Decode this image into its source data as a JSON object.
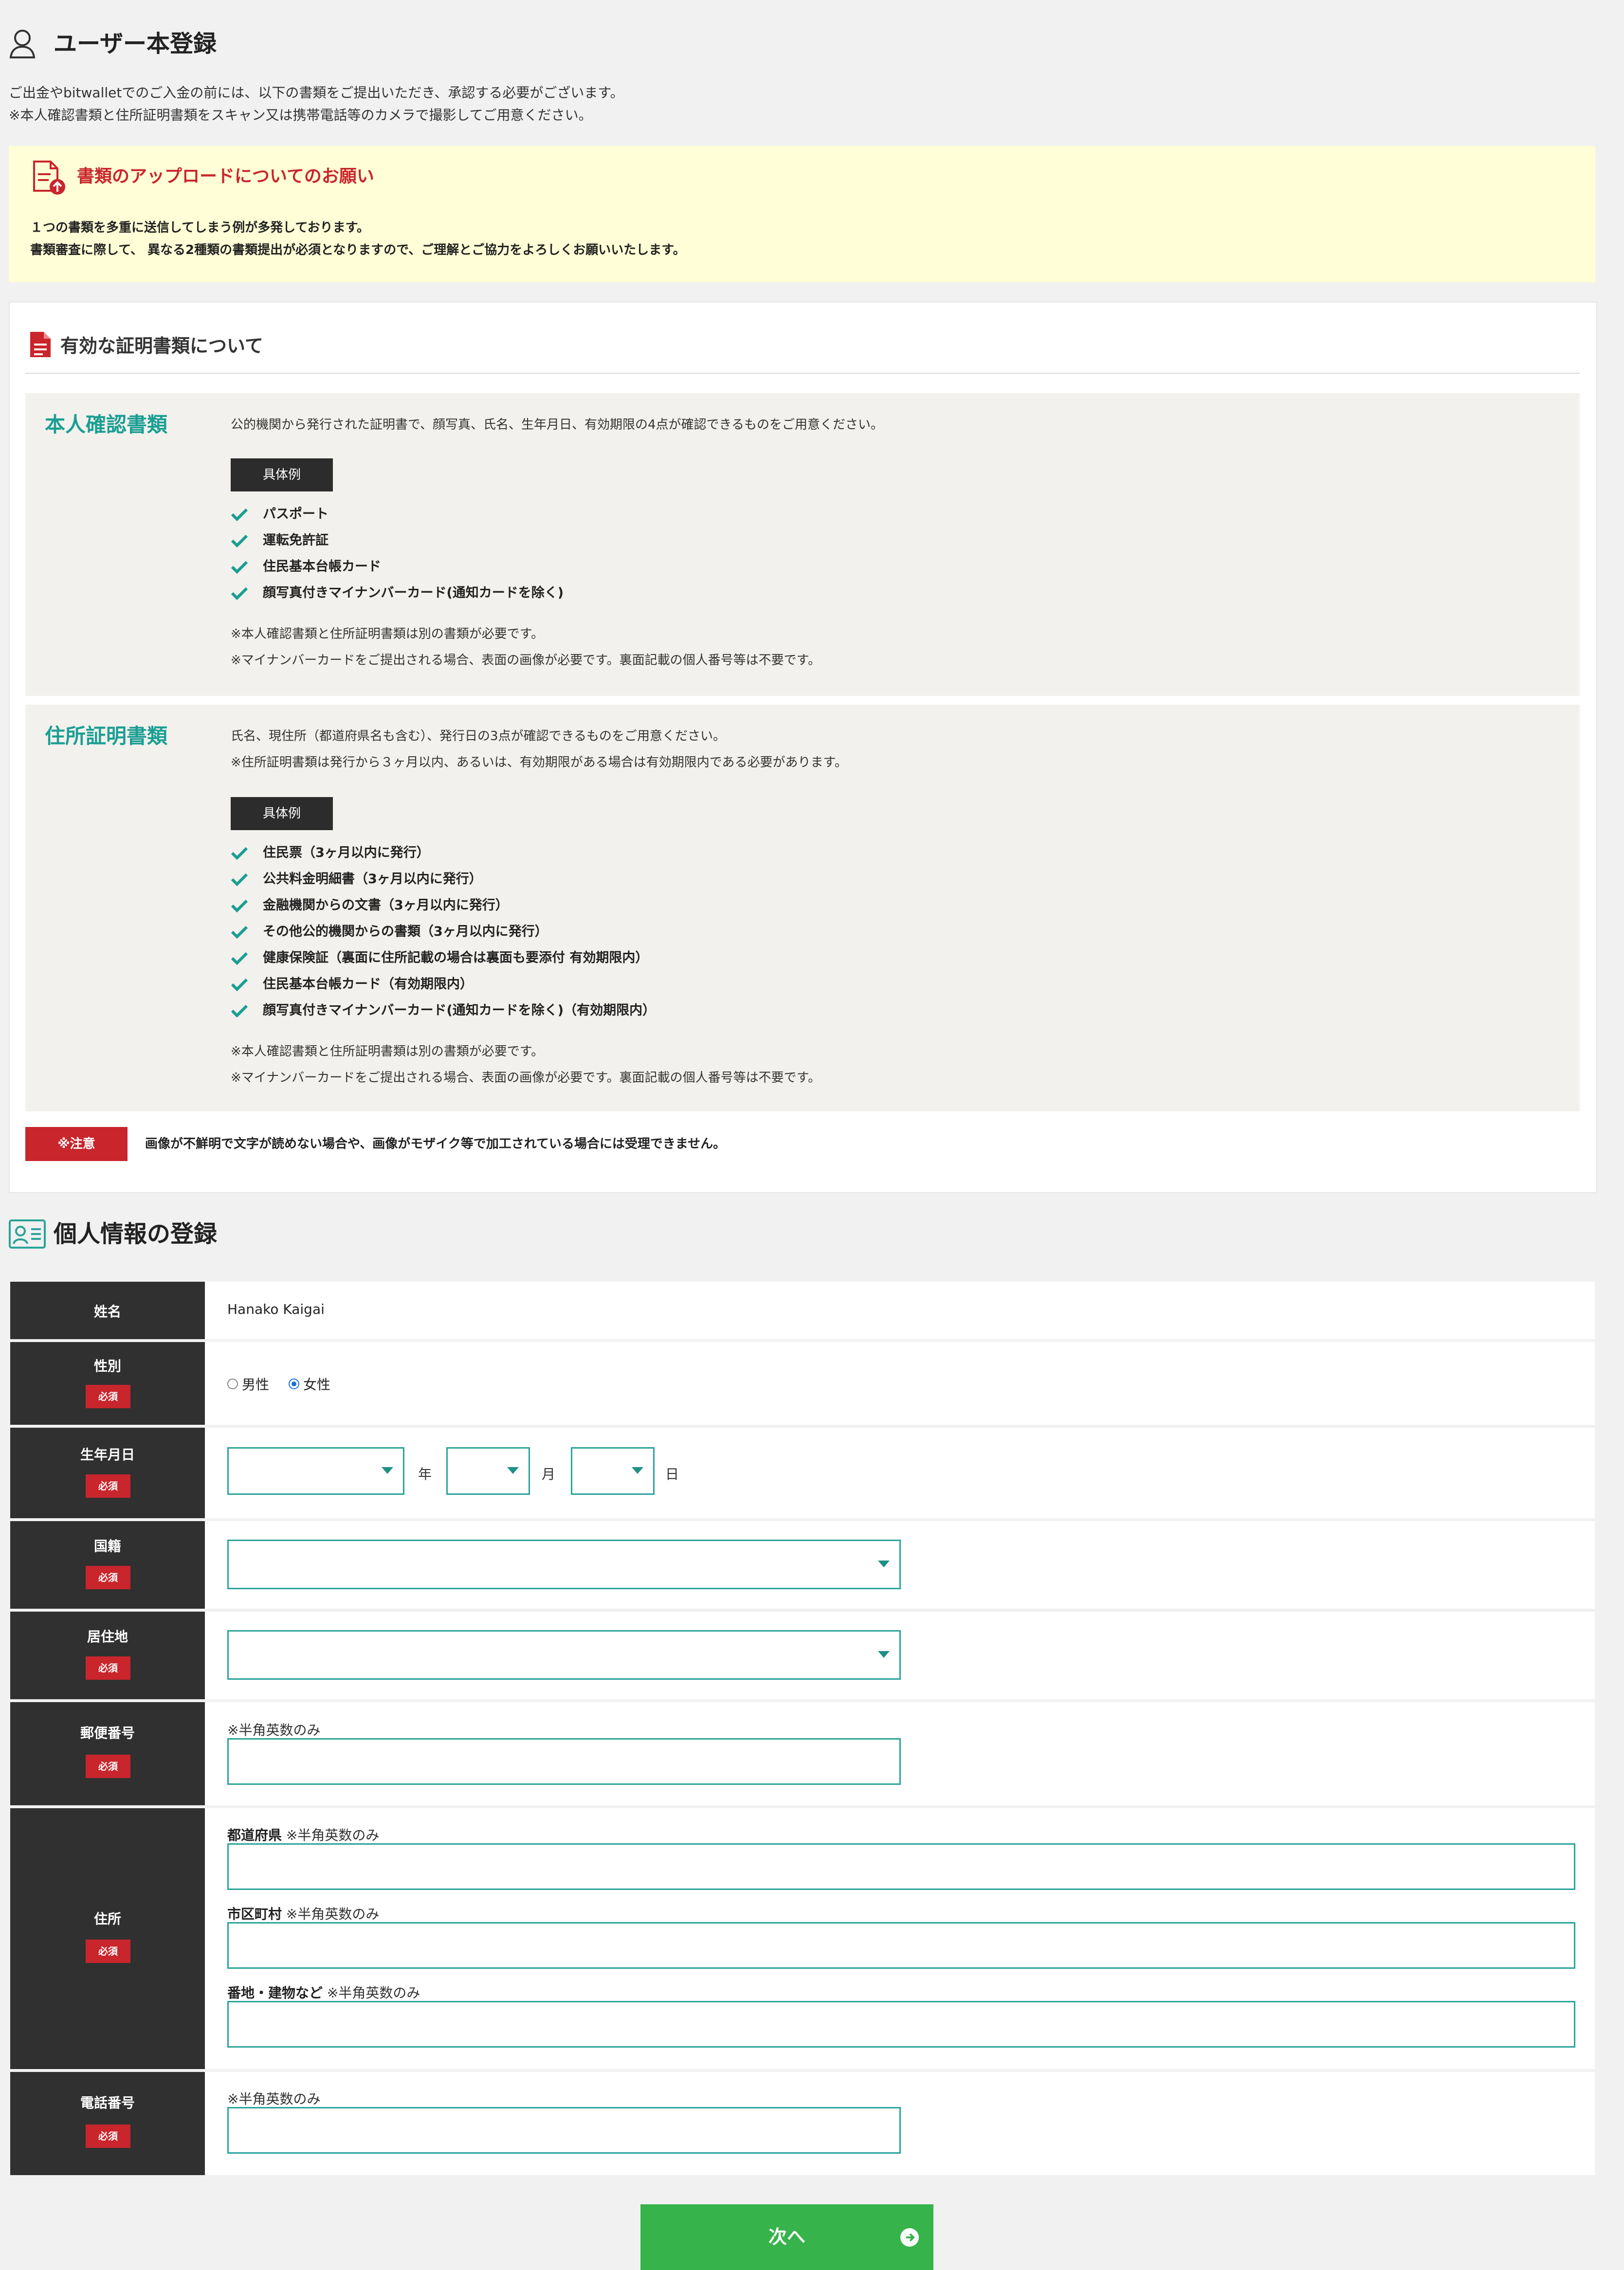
{
  "header": {
    "title": "ユーザー本登録",
    "intro_line1": "ご出金やbitwalletでのご入金の前には、以下の書類をご提出いただき、承認する必要がございます。",
    "intro_line2": "※本人確認書類と住所証明書類をスキャン又は携帯電話等のカメラで撮影してご用意ください。"
  },
  "notice": {
    "title": "書類のアップロードについてのお願い",
    "line1": "１つの書類を多重に送信してしまう例が多発しております。",
    "line2": "書類審査に際して、 異なる2種類の書類提出が必須となりますので、ご理解とご協力をよろしくお願いいたします。"
  },
  "docs": {
    "heading": "有効な証明書類について",
    "identity": {
      "name": "本人確認書類",
      "desc": "公的機関から発行された証明書で、顔写真、氏名、生年月日、有効期限の4点が確認できるものをご用意ください。",
      "example_label": "具体例",
      "items": [
        "パスポート",
        "運転免許証",
        "住民基本台帳カード",
        "顔写真付きマイナンバーカード(通知カードを除く)"
      ],
      "note1": "※本人確認書類と住所証明書類は別の書類が必要です。",
      "note2": "※マイナンバーカードをご提出される場合、表面の画像が必要です。裏面記載の個人番号等は不要です。"
    },
    "address": {
      "name": "住所証明書類",
      "desc1": "氏名、現住所（都道府県名も含む）、発行日の3点が確認できるものをご用意ください。",
      "desc2": "※住所証明書類は発行から３ヶ月以内、あるいは、有効期限がある場合は有効期限内である必要があります。",
      "example_label": "具体例",
      "items": [
        "住民票（3ヶ月以内に発行）",
        "公共料金明細書（3ヶ月以内に発行）",
        "金融機関からの文書（3ヶ月以内に発行）",
        "その他公的機関からの書類（3ヶ月以内に発行）",
        "健康保険証（裏面に住所記載の場合は裏面も要添付 有効期限内）",
        "住民基本台帳カード（有効期限内）",
        "顔写真付きマイナンバーカード(通知カードを除く)（有効期限内）"
      ],
      "note1": "※本人確認書類と住所証明書類は別の書類が必要です。",
      "note2": "※マイナンバーカードをご提出される場合、表面の画像が必要です。裏面記載の個人番号等は不要です。"
    },
    "caution_label": "※注意",
    "caution_text": "画像が不鮮明で文字が読めない場合や、画像がモザイク等で加工されている場合には受理できません。"
  },
  "form": {
    "heading": "個人情報の登録",
    "required_label": "必須",
    "name": {
      "label": "姓名",
      "value": "Hanako Kaigai"
    },
    "gender": {
      "label": "性別",
      "options": [
        "男性",
        "女性"
      ],
      "selected": "女性"
    },
    "birthdate": {
      "label": "生年月日",
      "year_unit": "年",
      "month_unit": "月",
      "day_unit": "日"
    },
    "nationality": {
      "label": "国籍"
    },
    "residence": {
      "label": "居住地"
    },
    "postal": {
      "label": "郵便番号",
      "hint": "※半角英数のみ"
    },
    "address": {
      "label": "住所",
      "prefecture_label": "都道府県",
      "city_label": "市区町村",
      "street_label": "番地・建物など",
      "hint": "※半角英数のみ"
    },
    "phone": {
      "label": "電話番号",
      "hint": "※半角英数のみ"
    }
  },
  "actions": {
    "next_label": "次へ"
  },
  "colors": {
    "accent": "#2aa39a",
    "heading_teal": "#1a9e93",
    "required_red": "#c9252c",
    "next_green": "#36b34a"
  }
}
